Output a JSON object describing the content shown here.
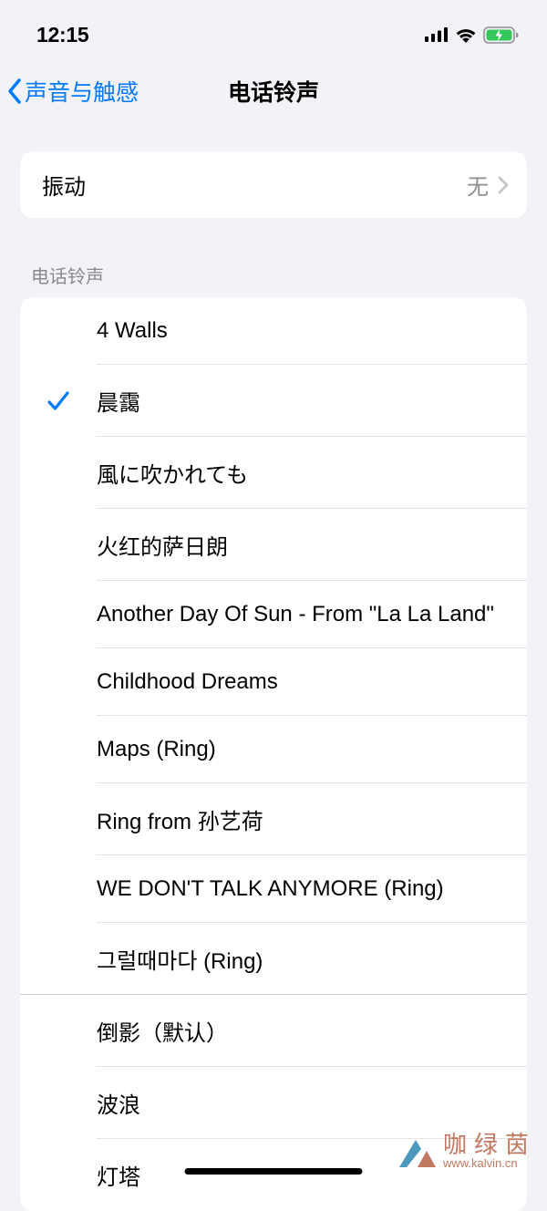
{
  "status_bar": {
    "time": "12:15"
  },
  "nav": {
    "back_label": "声音与触感",
    "title": "电话铃声"
  },
  "vibration": {
    "label": "振动",
    "value": "无"
  },
  "section_header": "电话铃声",
  "ringtones": [
    {
      "label": "4 Walls",
      "checked": false
    },
    {
      "label": "晨靄",
      "checked": true
    },
    {
      "label": "風に吹かれても",
      "checked": false
    },
    {
      "label": "火红的萨日朗",
      "checked": false
    },
    {
      "label": "Another Day Of Sun - From \"La La Land\"",
      "checked": false
    },
    {
      "label": "Childhood Dreams",
      "checked": false
    },
    {
      "label": "Maps (Ring)",
      "checked": false
    },
    {
      "label": "Ring from 孙艺荷",
      "checked": false
    },
    {
      "label": "WE DON'T TALK ANYMORE (Ring)",
      "checked": false
    },
    {
      "label": "그럴때마다 (Ring)",
      "checked": false
    }
  ],
  "system_ringtones": [
    {
      "label": "倒影（默认）"
    },
    {
      "label": "波浪"
    },
    {
      "label": "灯塔"
    }
  ],
  "watermark": {
    "cn": "咖绿茵",
    "url": "www.kalvin.cn"
  }
}
